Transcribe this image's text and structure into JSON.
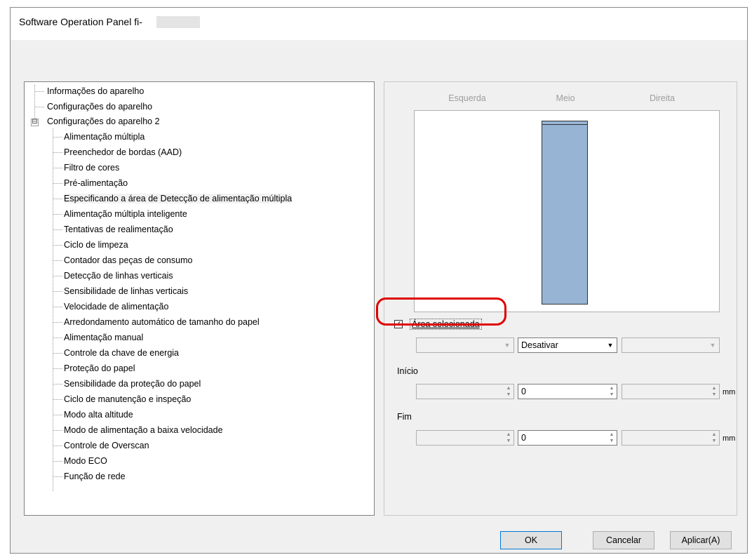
{
  "window": {
    "title": "Software Operation Panel fi-"
  },
  "tree": {
    "items": [
      {
        "label": "Informações do aparelho"
      },
      {
        "label": "Configurações do aparelho"
      },
      {
        "label": "Configurações do aparelho 2",
        "expander": "⊟"
      },
      {
        "label": "Alimentação múltipla"
      },
      {
        "label": "Preenchedor de bordas (AAD)"
      },
      {
        "label": "Filtro de cores"
      },
      {
        "label": "Pré-alimentação"
      },
      {
        "label": "Especificando a área de Detecção de alimentação múltipla"
      },
      {
        "label": "Alimentação múltipla inteligente"
      },
      {
        "label": "Tentativas de realimentação"
      },
      {
        "label": "Ciclo de limpeza"
      },
      {
        "label": "Contador das peças de consumo"
      },
      {
        "label": "Detecção de linhas verticais"
      },
      {
        "label": "Sensibilidade de linhas verticais"
      },
      {
        "label": "Velocidade de alimentação"
      },
      {
        "label": "Arredondamento automático de tamanho do papel"
      },
      {
        "label": "Alimentação manual"
      },
      {
        "label": "Controle da chave de energia"
      },
      {
        "label": "Proteção do papel"
      },
      {
        "label": "Sensibilidade da proteção do papel"
      },
      {
        "label": "Ciclo de manutenção e inspeção"
      },
      {
        "label": "Modo alta altitude"
      },
      {
        "label": "Modo de alimentação a baixa velocidade"
      },
      {
        "label": "Controle de Overscan"
      },
      {
        "label": "Modo ECO"
      },
      {
        "label": "Função de rede"
      }
    ]
  },
  "panel": {
    "columns": [
      "Esquerda",
      "Meio",
      "Direita"
    ],
    "checkbox": {
      "label": "Área selecionada",
      "checked": true,
      "mark": "✓"
    },
    "combos": [
      {
        "value": ""
      },
      {
        "value": "Desativar"
      },
      {
        "value": ""
      }
    ],
    "start": {
      "label": "Início",
      "values": [
        "",
        "0",
        ""
      ],
      "unit": "mm"
    },
    "end": {
      "label": "Fim",
      "values": [
        "",
        "0",
        ""
      ],
      "unit": "mm"
    }
  },
  "buttons": {
    "ok": "OK",
    "cancel": "Cancelar",
    "apply": "Aplicar(A)"
  },
  "icons": {
    "dropdown": "▼",
    "spin_up": "▲",
    "spin_down": "▼"
  },
  "colors": {
    "highlight": "#e00000",
    "preview_bar": "#97b4d4"
  }
}
